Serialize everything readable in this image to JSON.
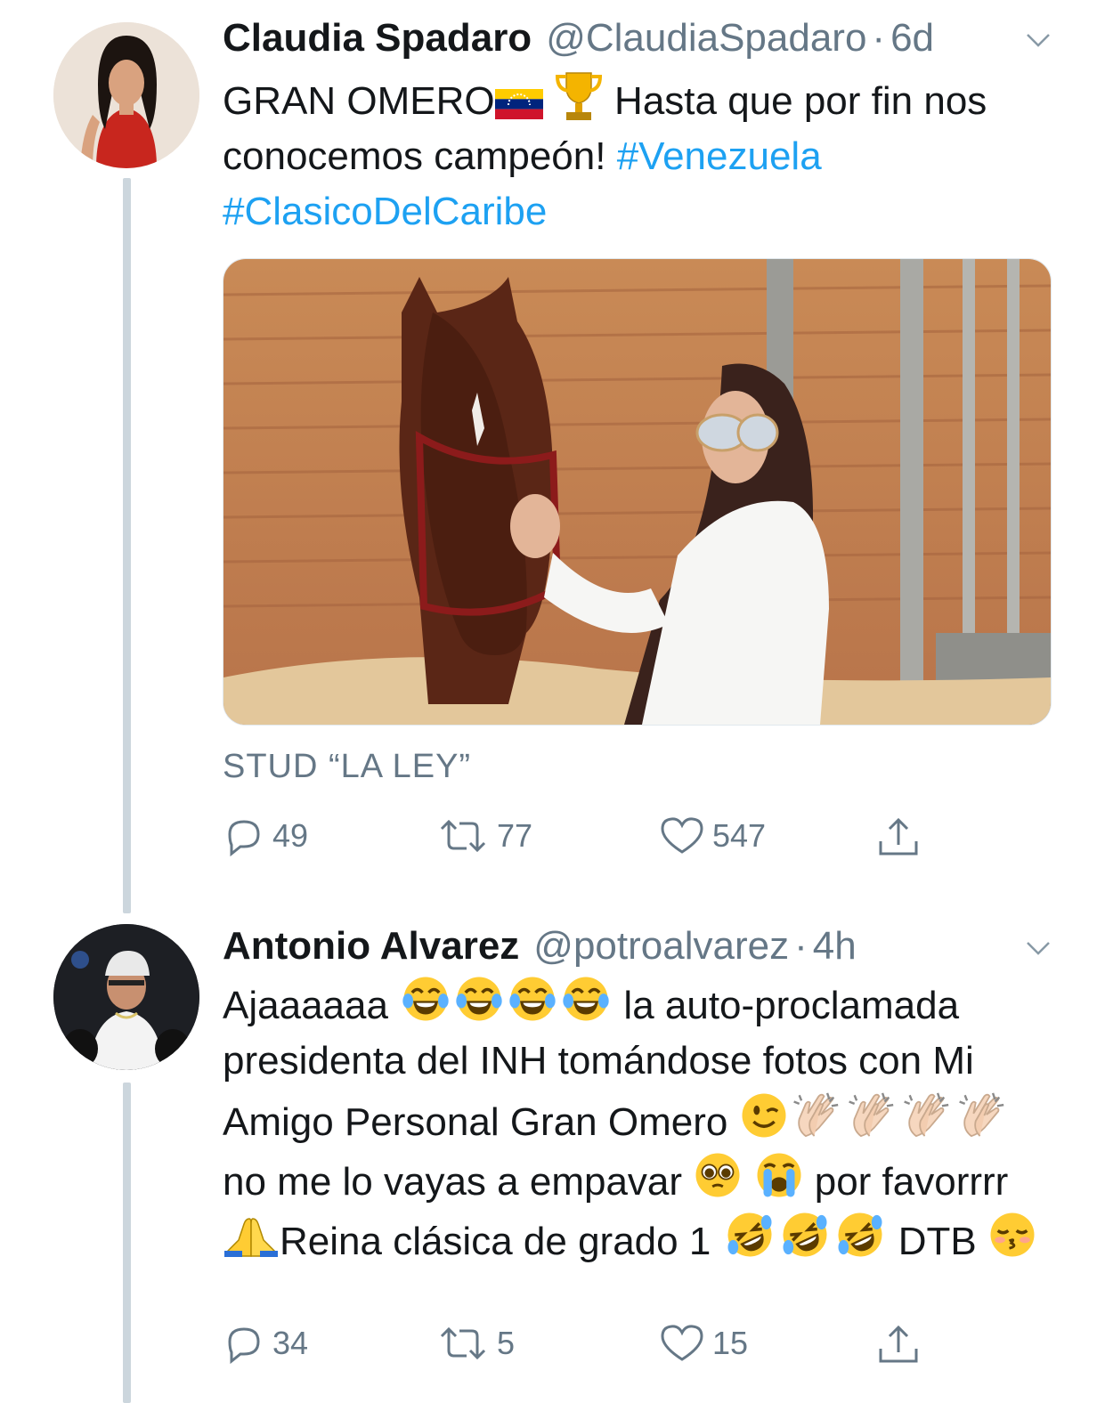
{
  "tweets": [
    {
      "author_name": "Claudia Spadaro",
      "author_handle": "@ClaudiaSpadaro",
      "separator": "·",
      "time": "6d",
      "text_part1": "GRAN OMERO",
      "text_part2": " Hasta que por fin nos conocemos campeón! ",
      "hashtag1": "#Venezuela",
      "hashtag2": "#ClasicoDelCaribe",
      "media_caption": "STUD “LA LEY”",
      "replies": "49",
      "retweets": "77",
      "likes": "547",
      "icons": [
        "avatar-photo",
        "chevron-down-icon",
        "venezuela-flag-emoji",
        "trophy-emoji",
        "reply-icon",
        "retweet-icon",
        "heart-icon",
        "share-icon"
      ]
    },
    {
      "author_name": "Antonio Alvarez",
      "author_handle": "@potroalvarez",
      "separator": "·",
      "time": "4h",
      "text_a": "Ajaaaaaa",
      "text_b": " la auto-proclamada presidenta del INH tomándose fotos con Mi Amigo Personal Gran Omero ",
      "text_c": " no me lo vayas a empavar ",
      "text_d": " por favorrrr ",
      "text_e": "Reina clásica de grado 1 ",
      "text_f": " DTB ",
      "replies": "34",
      "retweets": "5",
      "likes": "15",
      "icons": [
        "avatar-photo",
        "chevron-down-icon",
        "tears-of-joy-emoji",
        "wink-emoji",
        "clapping-emoji",
        "pleading-emoji",
        "crying-emoji",
        "pray-emoji",
        "rofl-emoji",
        "kissing-emoji",
        "reply-icon",
        "retweet-icon",
        "heart-icon",
        "share-icon"
      ]
    }
  ],
  "colors": {
    "link": "#1da1f2",
    "secondary_text": "#657786",
    "thread_line": "#ccd6dd"
  }
}
